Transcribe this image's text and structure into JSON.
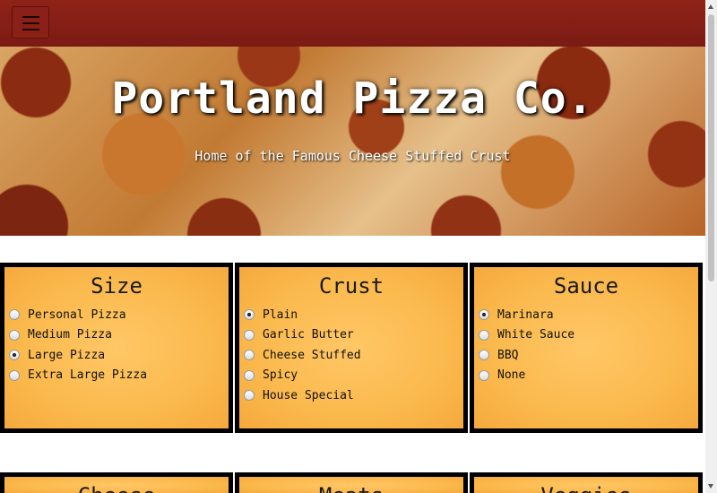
{
  "navbar": {
    "menu_icon": "hamburger-menu-icon"
  },
  "hero": {
    "title": "Portland Pizza Co.",
    "subtitle": "Home of the Famous Cheese Stuffed Crust"
  },
  "panels": {
    "size": {
      "title": "Size",
      "options": [
        "Personal Pizza",
        "Medium Pizza",
        "Large Pizza",
        "Extra Large Pizza"
      ],
      "selected": "Large Pizza"
    },
    "crust": {
      "title": "Crust",
      "options": [
        "Plain",
        "Garlic Butter",
        "Cheese Stuffed",
        "Spicy",
        "House Special"
      ],
      "selected": "Plain"
    },
    "sauce": {
      "title": "Sauce",
      "options": [
        "Marinara",
        "White Sauce",
        "BBQ",
        "None"
      ],
      "selected": "Marinara"
    },
    "cheese": {
      "title": "Cheese"
    },
    "meats": {
      "title": "Meats"
    },
    "veggies": {
      "title": "Veggies"
    }
  },
  "colors": {
    "navbar": "#8f2219",
    "panel_fill": "#fbb94d",
    "panel_border": "#000000"
  }
}
